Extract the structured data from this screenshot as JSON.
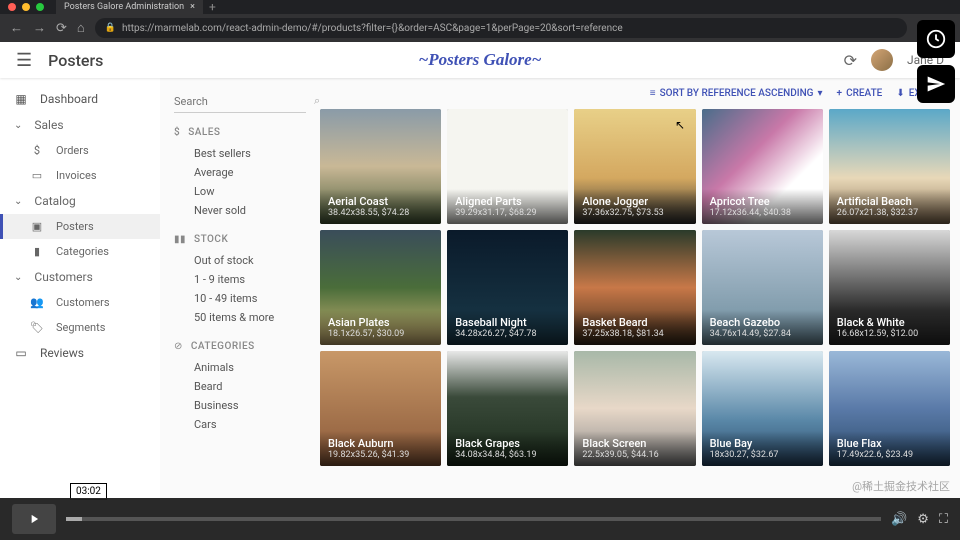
{
  "browser": {
    "tab_title": "Posters Galore Administration",
    "url": "https://marmelab.com/react-admin-demo/#/products?filter={}&order=ASC&page=1&perPage=20&sort=reference"
  },
  "topbar": {
    "page_title": "Posters",
    "brand": "~Posters Galore~",
    "user_name": "Jane D"
  },
  "sidebar": {
    "dashboard": "Dashboard",
    "sales": "Sales",
    "orders": "Orders",
    "invoices": "Invoices",
    "catalog": "Catalog",
    "posters": "Posters",
    "categories": "Categories",
    "customers_section": "Customers",
    "customers": "Customers",
    "segments": "Segments",
    "reviews": "Reviews"
  },
  "filters": {
    "search_placeholder": "Search",
    "sales_head": "SALES",
    "sales": [
      "Best sellers",
      "Average",
      "Low",
      "Never sold"
    ],
    "stock_head": "STOCK",
    "stock": [
      "Out of stock",
      "1 - 9 items",
      "10 - 49 items",
      "50 items & more"
    ],
    "categories_head": "CATEGORIES",
    "categories": [
      "Animals",
      "Beard",
      "Business",
      "Cars"
    ]
  },
  "toolbar": {
    "sort": "SORT BY REFERENCE ASCENDING",
    "create": "CREATE",
    "export": "EXPORT"
  },
  "posters": [
    {
      "title": "Aerial Coast",
      "meta": "38.42x38.55, $74.28",
      "bg": "bg1"
    },
    {
      "title": "Aligned Parts",
      "meta": "39.29x31.17, $68.29",
      "bg": "bg2"
    },
    {
      "title": "Alone Jogger",
      "meta": "37.36x32.75, $73.53",
      "bg": "bg3"
    },
    {
      "title": "Apricot Tree",
      "meta": "17.12x36.44, $40.38",
      "bg": "bg4"
    },
    {
      "title": "Artificial Beach",
      "meta": "26.07x21.38, $32.37",
      "bg": "bg5"
    },
    {
      "title": "Asian Plates",
      "meta": "18.1x26.57, $30.09",
      "bg": "bg6"
    },
    {
      "title": "Baseball Night",
      "meta": "34.28x26.27, $47.78",
      "bg": "bg7"
    },
    {
      "title": "Basket Beard",
      "meta": "37.25x38.18, $81.34",
      "bg": "bg8"
    },
    {
      "title": "Beach Gazebo",
      "meta": "34.76x14.49, $27.84",
      "bg": "bg9"
    },
    {
      "title": "Black & White",
      "meta": "16.68x12.59, $12.00",
      "bg": "bg10"
    },
    {
      "title": "Black Auburn",
      "meta": "19.82x35.26, $41.39",
      "bg": "bg11"
    },
    {
      "title": "Black Grapes",
      "meta": "34.08x34.84, $63.19",
      "bg": "bg12"
    },
    {
      "title": "Black Screen",
      "meta": "22.5x39.05, $44.16",
      "bg": "bg13"
    },
    {
      "title": "Blue Bay",
      "meta": "18x30.27, $32.67",
      "bg": "bg14"
    },
    {
      "title": "Blue Flax",
      "meta": "17.49x22.6, $23.49",
      "bg": "bg15"
    }
  ],
  "video": {
    "time": "03:02"
  },
  "watermark": "@稀土掘金技术社区"
}
